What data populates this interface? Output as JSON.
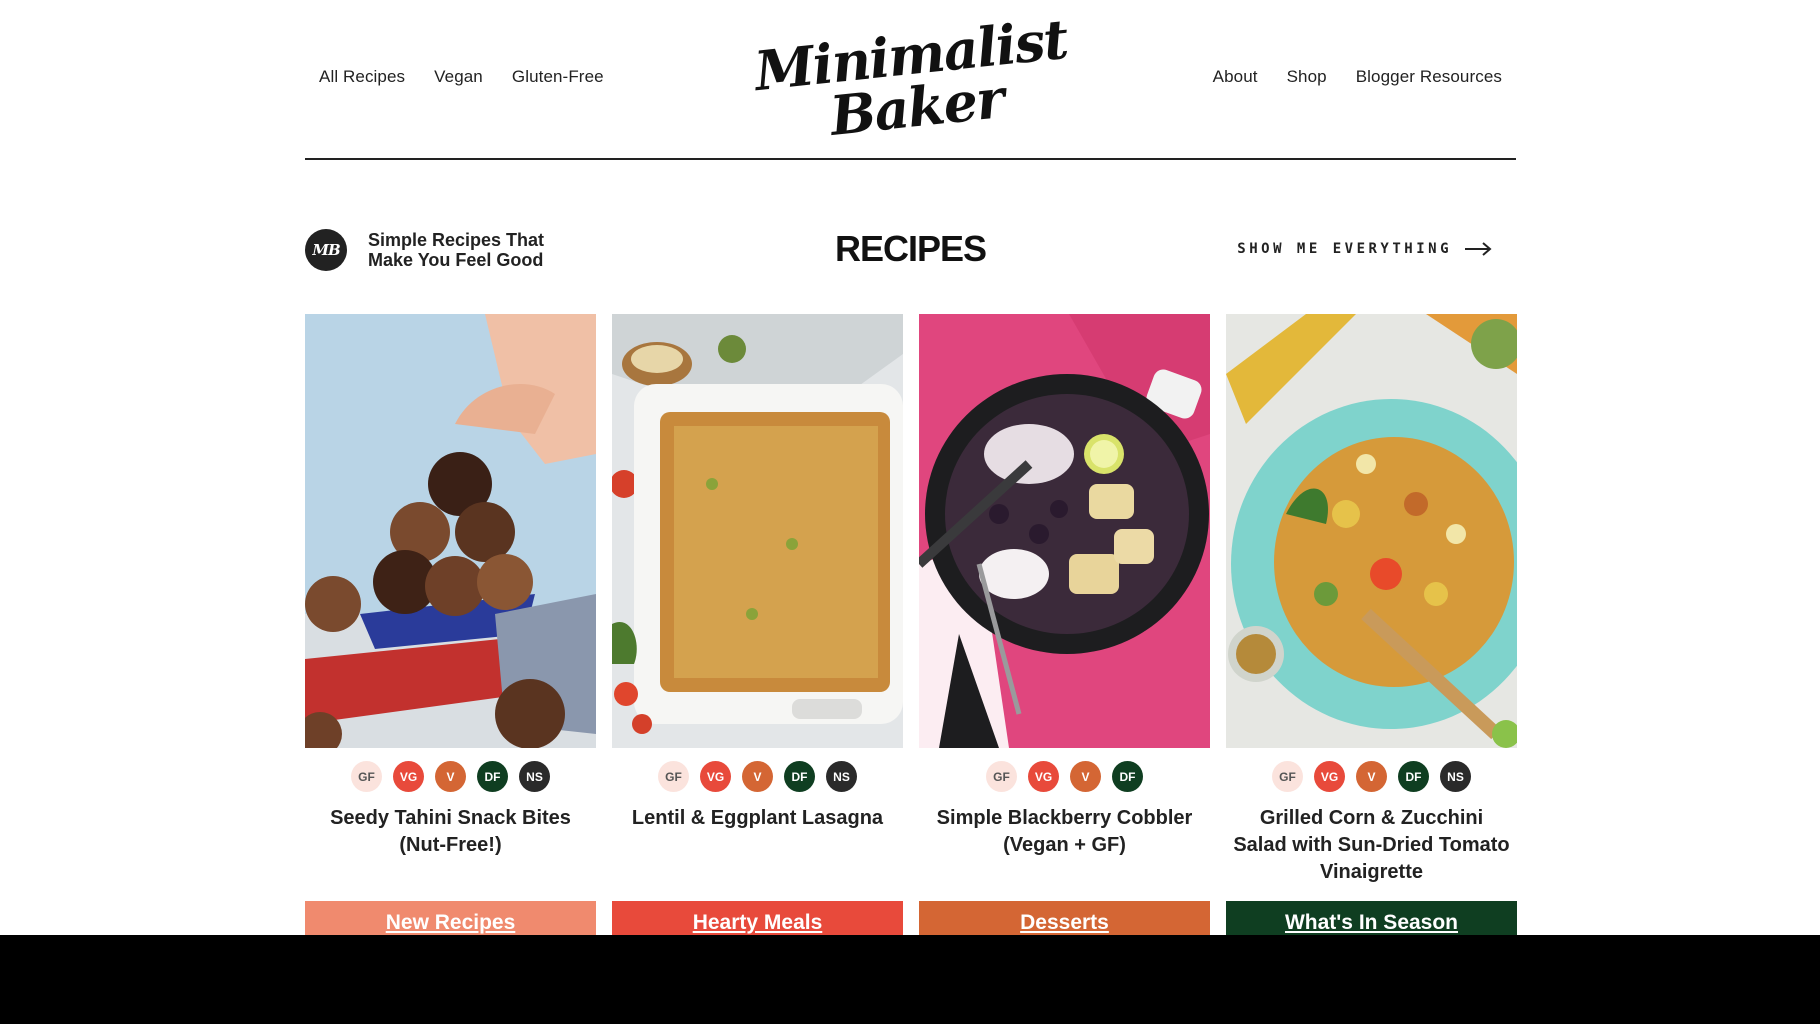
{
  "header": {
    "nav_left": [
      "All Recipes",
      "Vegan",
      "Gluten-Free"
    ],
    "nav_right": [
      "About",
      "Shop",
      "Blogger Resources"
    ],
    "logo_line1": "Minimalist",
    "logo_line2": "Baker"
  },
  "section": {
    "badge": "MB",
    "tagline": "Simple Recipes That Make You Feel Good",
    "title": "RECIPES",
    "show_all": "SHOW ME EVERYTHING"
  },
  "cards": [
    {
      "title": "Seedy Tahini Snack Bites (Nut-Free!)",
      "badges": [
        "GF",
        "VG",
        "V",
        "DF",
        "NS"
      ],
      "category": "New Recipes",
      "category_color": "#f08a6e"
    },
    {
      "title": "Lentil & Eggplant Lasagna",
      "badges": [
        "GF",
        "VG",
        "V",
        "DF",
        "NS"
      ],
      "category": "Hearty Meals",
      "category_color": "#e84a3b"
    },
    {
      "title": "Simple Blackberry Cobbler (Vegan + GF)",
      "badges": [
        "GF",
        "VG",
        "V",
        "DF"
      ],
      "category": "Desserts",
      "category_color": "#d46634"
    },
    {
      "title": "Grilled Corn & Zucchini Salad with Sun-Dried Tomato Vinaigrette",
      "badges": [
        "GF",
        "VG",
        "V",
        "DF",
        "NS"
      ],
      "category": "What's In Season",
      "category_color": "#0f3e21"
    }
  ],
  "colors": {
    "gf": "#fbe3dd",
    "vg": "#e84a3b",
    "v": "#d46634",
    "df": "#0f3e21",
    "ns": "#2a2a2a"
  }
}
